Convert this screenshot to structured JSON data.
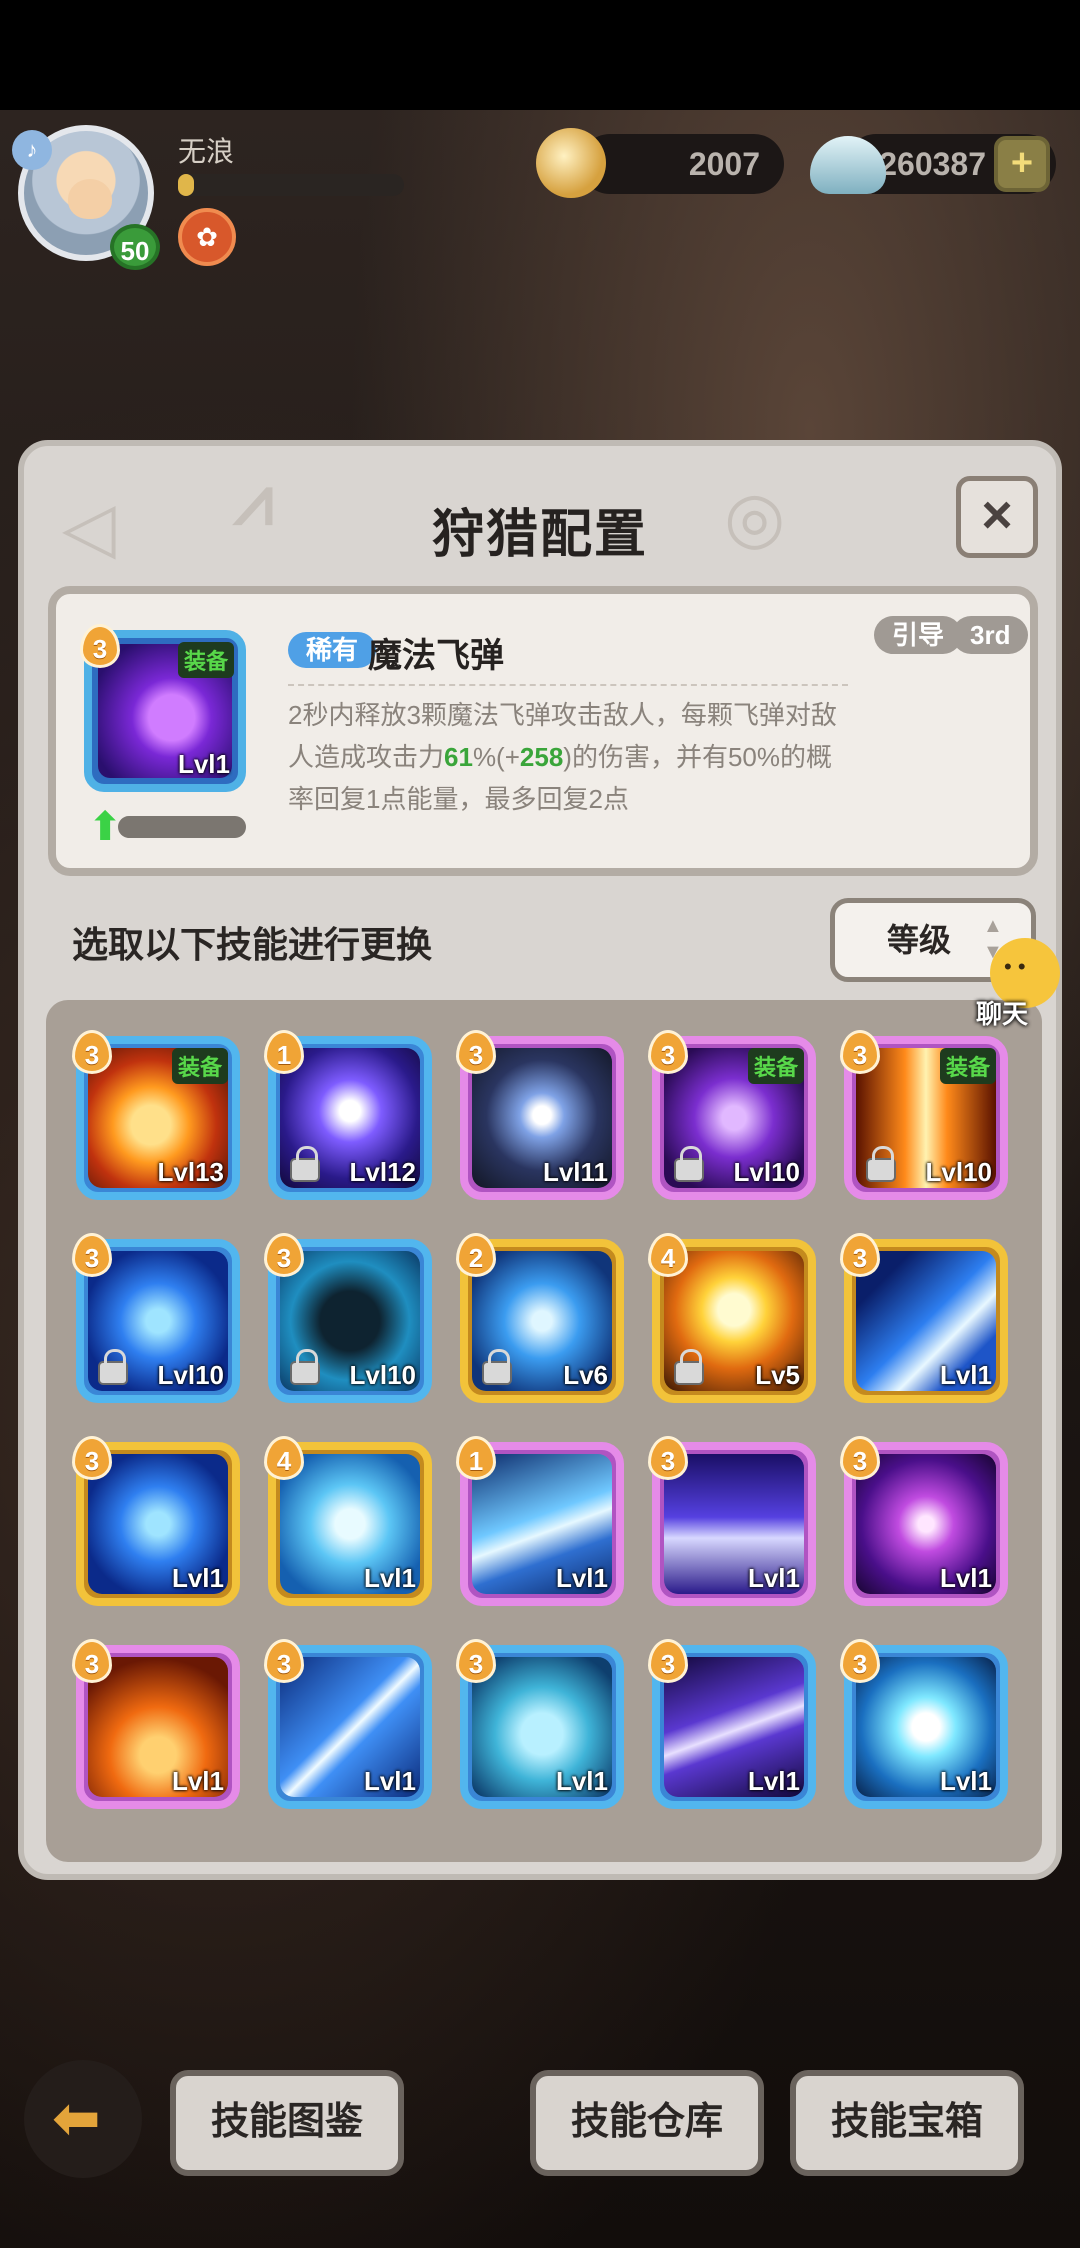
{
  "player": {
    "name": "无浪",
    "level": "50",
    "xp_fraction": 0.07
  },
  "currency": {
    "coins": "2007",
    "shells": "260387"
  },
  "dialog": {
    "title": "狩猎配置",
    "close_label": "×",
    "selected_skill": {
      "rarity": "稀有",
      "name": "魔法飞弹",
      "tags": [
        "引导",
        "3rd"
      ],
      "cost": "3",
      "equipped_label": "装备",
      "level": "Lvl1",
      "upgrade_fraction": 0.0,
      "description_parts": [
        "2秒内释放3颗魔法飞弹攻击敌人，每颗飞弹对敌人造成攻击力",
        "61",
        "%(+",
        "258",
        ")的伤害，并有50%的概率回复1点能量，最多回复2点"
      ]
    },
    "select_label": "选取以下技能进行更换",
    "sort": {
      "label": "等级"
    },
    "skills": [
      {
        "cost": "3",
        "level": "Lvl13",
        "frame": "blue",
        "equipped": true,
        "locked": false,
        "icon": "fireball-icon",
        "bg": "radial-gradient(circle at 45% 55%, #ffe08a 0 18%, #ff9a1f 35%, #c0320e 60%, #3a0f05 100%)"
      },
      {
        "cost": "1",
        "level": "Lvl12",
        "frame": "blue",
        "equipped": false,
        "locked": true,
        "icon": "void-eye-icon",
        "bg": "radial-gradient(circle at 50% 45%, #ffffff 0 10%, #7e5cff 30%, #2a1a8a 65%, #12093a 100%)"
      },
      {
        "cost": "3",
        "level": "Lvl11",
        "frame": "purple",
        "equipped": false,
        "locked": false,
        "icon": "hexagram-orb-icon",
        "bg": "radial-gradient(circle at 50% 48%, #ffffff 0 9%, #7fa2e6 22%, #2a3560 55%, #121624 100%)"
      },
      {
        "cost": "3",
        "level": "Lvl10",
        "frame": "purple",
        "equipped": true,
        "locked": true,
        "icon": "shadow-orb-icon",
        "bg": "radial-gradient(circle at 50% 50%, #e1b8ff 0 12%, #7b2ecf 40%, #2a0b55 80%)"
      },
      {
        "cost": "3",
        "level": "Lvl10",
        "frame": "purple",
        "equipped": true,
        "locked": true,
        "icon": "fire-pillar-icon",
        "bg": "linear-gradient(90deg, #5a1200, #ff8a1a 35%, #fff2b0 50%, #ff8a1a 65%, #5a1200)"
      },
      {
        "cost": "3",
        "level": "Lvl10",
        "frame": "blue",
        "equipped": false,
        "locked": true,
        "icon": "vortex-icon",
        "bg": "radial-gradient(circle at 50% 50%, #9fe4ff 0 12%, #2f7ff0 38%, #0b2a8a 75%)"
      },
      {
        "cost": "3",
        "level": "Lvl10",
        "frame": "blue",
        "equipped": false,
        "locked": true,
        "icon": "skull-block-icon",
        "bg": "radial-gradient(circle at 50% 50%, #0e2330 0 30%, #1f8ec0 60%, #0b3a66 100%)"
      },
      {
        "cost": "2",
        "level": "Lv6",
        "frame": "gold",
        "equipped": false,
        "locked": true,
        "icon": "spin-blade-icon",
        "bg": "radial-gradient(circle at 50% 50%, #dff6ff 0 10%, #3b9cf0 38%, #10357a 80%)"
      },
      {
        "cost": "4",
        "level": "Lv5",
        "frame": "gold",
        "equipped": false,
        "locked": true,
        "icon": "sun-orb-icon",
        "bg": "radial-gradient(circle at 50% 42%, #fffbd0 0 15%, #ffd23a 30%, #e06a10 55%, #3a1804 100%)"
      },
      {
        "cost": "3",
        "level": "Lvl1",
        "frame": "gold",
        "equipped": false,
        "locked": false,
        "icon": "comet-icon",
        "bg": "linear-gradient(135deg, #0a1f6a 20%, #2d7ef0 50%, #e8f8ff 65%, #1e55c8 80%)"
      },
      {
        "cost": "3",
        "level": "Lvl1",
        "frame": "gold",
        "equipped": false,
        "locked": false,
        "icon": "vortex-icon",
        "bg": "radial-gradient(circle at 50% 50%, #9fe4ff 0 12%, #2f7ff0 38%, #0b2a8a 75%)"
      },
      {
        "cost": "4",
        "level": "Lvl1",
        "frame": "gold",
        "equipped": false,
        "locked": false,
        "icon": "tornado-icon",
        "bg": "radial-gradient(circle at 50% 50%, #e8fbff 0 15%, #5cc6f5 40%, #1560b0 80%)"
      },
      {
        "cost": "1",
        "level": "Lvl1",
        "frame": "purple",
        "equipped": false,
        "locked": false,
        "icon": "ice-shard-icon",
        "bg": "linear-gradient(160deg, #0c2a6a, #6fc8ff 45%, #e6f8ff 55%, #2f6fd0 70%, #0c2a6a)"
      },
      {
        "cost": "3",
        "level": "Lvl1",
        "frame": "purple",
        "equipped": false,
        "locked": false,
        "icon": "light-spikes-icon",
        "bg": "linear-gradient(180deg, #1a0f66, #5540e0 45%, #d8d8ff 60%, #2a1a8a)"
      },
      {
        "cost": "3",
        "level": "Lvl1",
        "frame": "purple",
        "equipped": false,
        "locked": false,
        "icon": "lightning-orb-icon",
        "bg": "radial-gradient(circle at 50% 50%, #ffe6ff 0 8%, #c04be0 28%, #4a0f8a 65%, #180530 100%)"
      },
      {
        "cost": "3",
        "level": "Lvl1",
        "frame": "purple",
        "equipped": false,
        "locked": false,
        "icon": "fire-golem-icon",
        "bg": "radial-gradient(circle at 50% 70%, #ffd070 0 15%, #f06a10 40%, #6a1804 80%)"
      },
      {
        "cost": "3",
        "level": "Lvl1",
        "frame": "blue",
        "equipped": false,
        "locked": false,
        "icon": "slash-icon",
        "bg": "linear-gradient(135deg, #0b2a7a, #3f8ff5 45%, #f0fbff 52%, #3f8ff5 60%, #0b2a7a)"
      },
      {
        "cost": "3",
        "level": "Lvl1",
        "frame": "blue",
        "equipped": false,
        "locked": false,
        "icon": "ice-spirit-icon",
        "bg": "radial-gradient(circle at 50% 55%, #b8f0ff 0 20%, #3fb4d8 45%, #0e3f6e 85%)"
      },
      {
        "cost": "3",
        "level": "Lvl1",
        "frame": "blue",
        "equipped": false,
        "locked": false,
        "icon": "thunder-bolt-icon",
        "bg": "linear-gradient(160deg, #12083a, #5a38d0 40%, #e8e0ff 52%, #5a38d0 62%, #12083a)"
      },
      {
        "cost": "3",
        "level": "Lvl1",
        "frame": "blue",
        "equipped": false,
        "locked": false,
        "icon": "snowflake-icon",
        "bg": "radial-gradient(circle at 50% 50%, #ffffff 0 14%, #7fe8ff 30%, #1a6fc0 65%, #08224a 100%)"
      }
    ],
    "chat_label": "聊天"
  },
  "bottom": {
    "codex_label": "技能图鉴",
    "storage_label": "技能仓库",
    "chest_label": "技能宝箱"
  }
}
